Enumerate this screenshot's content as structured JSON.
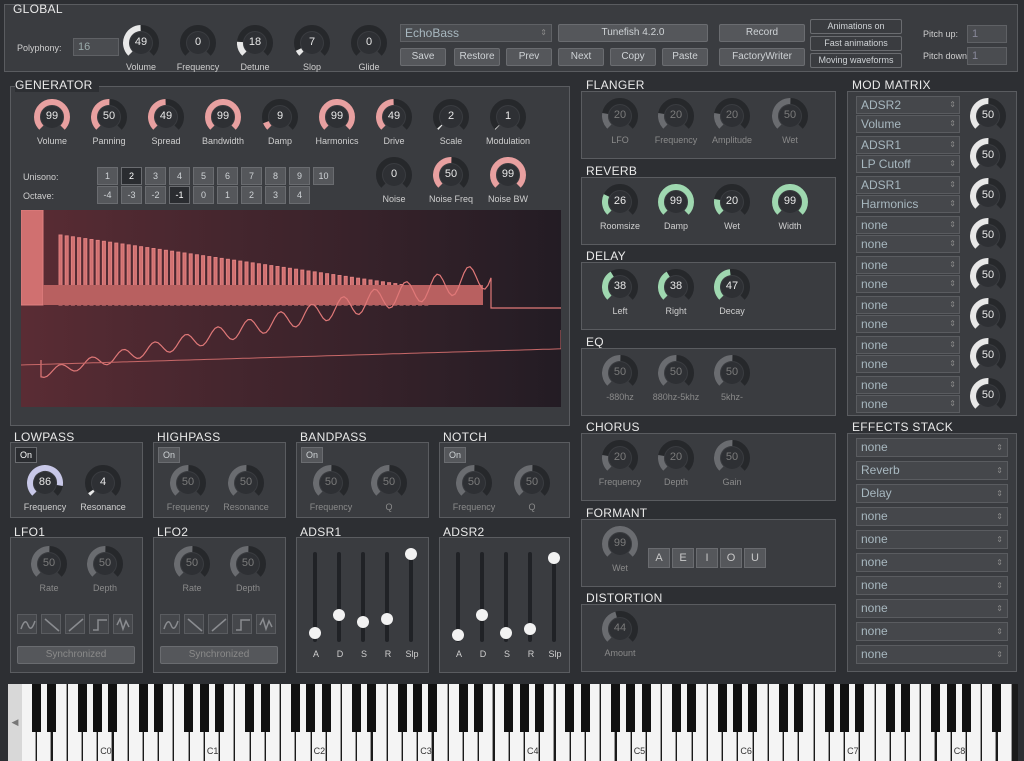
{
  "global": {
    "title": "GLOBAL",
    "polyphony_label": "Polyphony:",
    "polyphony_value": "16",
    "knobs": [
      {
        "label": "Volume",
        "value": "49"
      },
      {
        "label": "Frequency",
        "value": "0"
      },
      {
        "label": "Detune",
        "value": "18"
      },
      {
        "label": "Slop",
        "value": "7"
      },
      {
        "label": "Glide",
        "value": "0"
      }
    ],
    "preset_name": "EchoBass",
    "version": "Tunefish 4.2.0",
    "buttons": {
      "save": "Save",
      "restore": "Restore",
      "prev": "Prev",
      "next": "Next",
      "copy": "Copy",
      "paste": "Paste",
      "record": "Record",
      "factory": "FactoryWriter"
    },
    "toggles": [
      "Animations on",
      "Fast animations",
      "Moving waveforms"
    ],
    "pitch_up_label": "Pitch up:",
    "pitch_up_value": "1",
    "pitch_down_label": "Pitch down:",
    "pitch_down_value": "1"
  },
  "generator": {
    "title": "GENERATOR",
    "knobs": [
      {
        "label": "Volume",
        "value": "99"
      },
      {
        "label": "Panning",
        "value": "50"
      },
      {
        "label": "Spread",
        "value": "49"
      },
      {
        "label": "Bandwidth",
        "value": "99"
      },
      {
        "label": "Damp",
        "value": "9"
      },
      {
        "label": "Harmonics",
        "value": "99"
      },
      {
        "label": "Drive",
        "value": "49"
      },
      {
        "label": "Scale",
        "value": "2"
      },
      {
        "label": "Modulation",
        "value": "1"
      }
    ],
    "unisono_label": "Unisono:",
    "unisono_values": [
      "1",
      "2",
      "3",
      "4",
      "5",
      "6",
      "7",
      "8",
      "9",
      "10"
    ],
    "unisono_selected": "2",
    "octave_label": "Octave:",
    "octave_values": [
      "-4",
      "-3",
      "-2",
      "-1",
      "0",
      "1",
      "2",
      "3",
      "4"
    ],
    "octave_selected": "-1",
    "noise_knobs": [
      {
        "label": "Noise",
        "value": "0"
      },
      {
        "label": "Noise Freq",
        "value": "50"
      },
      {
        "label": "Noise BW",
        "value": "99"
      }
    ]
  },
  "flanger": {
    "title": "FLANGER",
    "knobs": [
      {
        "label": "LFO",
        "value": "20"
      },
      {
        "label": "Frequency",
        "value": "20"
      },
      {
        "label": "Amplitude",
        "value": "20"
      },
      {
        "label": "Wet",
        "value": "50"
      }
    ]
  },
  "reverb": {
    "title": "REVERB",
    "knobs": [
      {
        "label": "Roomsize",
        "value": "26"
      },
      {
        "label": "Damp",
        "value": "99"
      },
      {
        "label": "Wet",
        "value": "20"
      },
      {
        "label": "Width",
        "value": "99"
      }
    ]
  },
  "delay": {
    "title": "DELAY",
    "knobs": [
      {
        "label": "Left",
        "value": "38"
      },
      {
        "label": "Right",
        "value": "38"
      },
      {
        "label": "Decay",
        "value": "47"
      }
    ]
  },
  "eq": {
    "title": "EQ",
    "knobs": [
      {
        "label": "-880hz",
        "value": "50"
      },
      {
        "label": "880hz-5khz",
        "value": "50"
      },
      {
        "label": "5khz-",
        "value": "50"
      }
    ]
  },
  "chorus": {
    "title": "CHORUS",
    "knobs": [
      {
        "label": "Frequency",
        "value": "20"
      },
      {
        "label": "Depth",
        "value": "20"
      },
      {
        "label": "Gain",
        "value": "50"
      }
    ]
  },
  "formant": {
    "title": "FORMANT",
    "knob": {
      "label": "Wet",
      "value": "99"
    },
    "vowels": [
      "A",
      "E",
      "I",
      "O",
      "U"
    ]
  },
  "distortion": {
    "title": "DISTORTION",
    "knob": {
      "label": "Amount",
      "value": "44"
    }
  },
  "mod_matrix": {
    "title": "MOD MATRIX",
    "rows": [
      {
        "src": "ADSR2",
        "dst": "Volume",
        "value": "50"
      },
      {
        "src": "ADSR1",
        "dst": "LP Cutoff",
        "value": "50"
      },
      {
        "src": "ADSR1",
        "dst": "Harmonics",
        "value": "50"
      },
      {
        "src": "none",
        "dst": "none",
        "value": "50"
      },
      {
        "src": "none",
        "dst": "none",
        "value": "50"
      },
      {
        "src": "none",
        "dst": "none",
        "value": "50"
      },
      {
        "src": "none",
        "dst": "none",
        "value": "50"
      },
      {
        "src": "none",
        "dst": "none",
        "value": "50"
      }
    ]
  },
  "effects_stack": {
    "title": "EFFECTS STACK",
    "items": [
      "none",
      "Reverb",
      "Delay",
      "none",
      "none",
      "none",
      "none",
      "none",
      "none",
      "none"
    ]
  },
  "lowpass": {
    "title": "LOWPASS",
    "on": "On",
    "knobs": [
      {
        "label": "Frequency",
        "value": "86"
      },
      {
        "label": "Resonance",
        "value": "4"
      }
    ]
  },
  "highpass": {
    "title": "HIGHPASS",
    "on": "On",
    "knobs": [
      {
        "label": "Frequency",
        "value": "50"
      },
      {
        "label": "Resonance",
        "value": "50"
      }
    ]
  },
  "bandpass": {
    "title": "BANDPASS",
    "on": "On",
    "knobs": [
      {
        "label": "Frequency",
        "value": "50"
      },
      {
        "label": "Q",
        "value": "50"
      }
    ]
  },
  "notch": {
    "title": "NOTCH",
    "on": "On",
    "knobs": [
      {
        "label": "Frequency",
        "value": "50"
      },
      {
        "label": "Q",
        "value": "50"
      }
    ]
  },
  "lfo1": {
    "title": "LFO1",
    "knobs": [
      {
        "label": "Rate",
        "value": "50"
      },
      {
        "label": "Depth",
        "value": "50"
      }
    ],
    "sync": "Synchronized"
  },
  "lfo2": {
    "title": "LFO2",
    "knobs": [
      {
        "label": "Rate",
        "value": "50"
      },
      {
        "label": "Depth",
        "value": "50"
      }
    ],
    "sync": "Synchronized"
  },
  "adsr1": {
    "title": "ADSR1",
    "labels": [
      "A",
      "D",
      "S",
      "R",
      "Slp"
    ],
    "levels": [
      0.1,
      0.3,
      0.22,
      0.26,
      0.98
    ]
  },
  "adsr2": {
    "title": "ADSR2",
    "labels": [
      "A",
      "D",
      "S",
      "R",
      "Slp"
    ],
    "levels": [
      0.08,
      0.3,
      0.1,
      0.14,
      0.93
    ]
  },
  "keyboard": {
    "octaves": [
      "C0",
      "C1",
      "C2",
      "C3",
      "C4",
      "C5",
      "C6",
      "C7",
      "C8"
    ]
  },
  "colors": {
    "pink": "#e8a0a0",
    "green": "#9fd8b0",
    "white": "#e8e8e8",
    "dim": "#6a6c70"
  }
}
